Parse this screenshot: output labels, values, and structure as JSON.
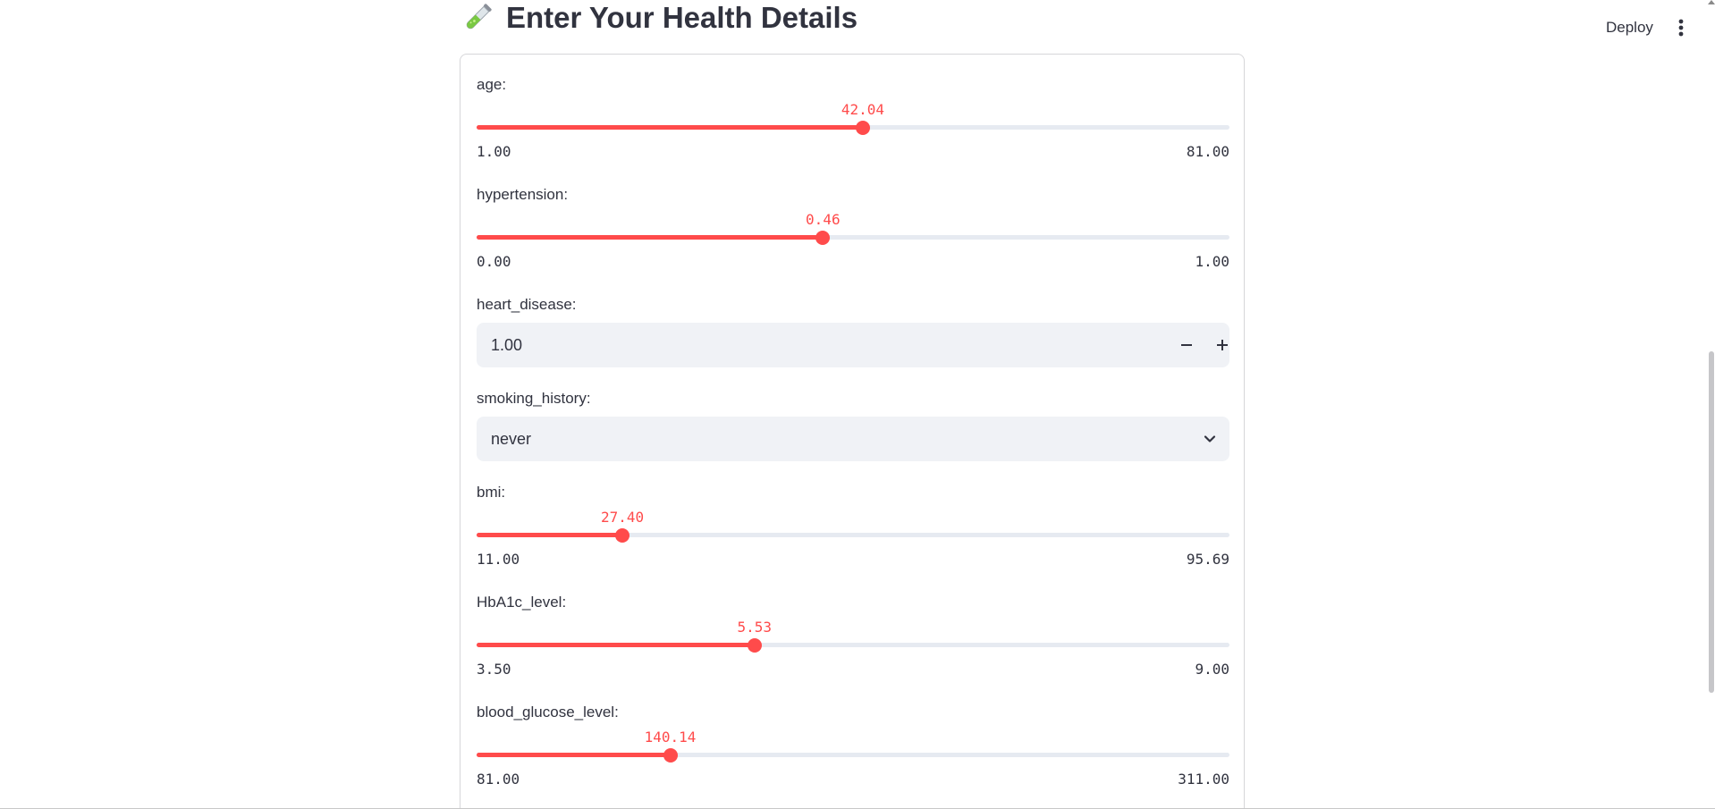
{
  "header": {
    "deploy_label": "Deploy",
    "menu_icon": "more-vertical-icon"
  },
  "page": {
    "title_icon": "test-tube-icon",
    "title": "Enter Your Health Details"
  },
  "form": {
    "age": {
      "label": "age:",
      "value": "42.04",
      "min": "1.00",
      "max": "81.00",
      "value_num": 42.04,
      "min_num": 1.0,
      "max_num": 81.0
    },
    "hypertension": {
      "label": "hypertension:",
      "value": "0.46",
      "min": "0.00",
      "max": "1.00",
      "value_num": 0.46,
      "min_num": 0.0,
      "max_num": 1.0
    },
    "heart_disease": {
      "label": "heart_disease:",
      "value": "1.00",
      "decrement_icon": "minus-icon",
      "increment_icon": "plus-icon"
    },
    "smoking_history": {
      "label": "smoking_history:",
      "value": "never",
      "chevron_icon": "chevron-down-icon"
    },
    "bmi": {
      "label": "bmi:",
      "value": "27.40",
      "min": "11.00",
      "max": "95.69",
      "value_num": 27.4,
      "min_num": 11.0,
      "max_num": 95.69
    },
    "hba1c": {
      "label": "HbA1c_level:",
      "value": "5.53",
      "min": "3.50",
      "max": "9.00",
      "value_num": 5.53,
      "min_num": 3.5,
      "max_num": 9.0
    },
    "glucose": {
      "label": "blood_glucose_level:",
      "value": "140.14",
      "min": "81.00",
      "max": "311.00",
      "value_num": 140.14,
      "min_num": 81.0,
      "max_num": 311.0
    }
  },
  "colors": {
    "accent": "#ff4b4b",
    "track": "#e6eaf1",
    "input_bg": "#f0f2f6",
    "text": "#31333f"
  }
}
